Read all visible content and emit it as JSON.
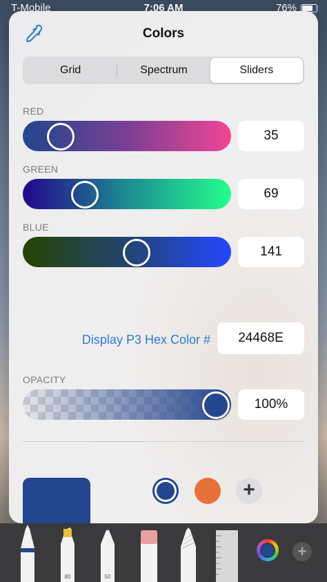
{
  "status_bar": {
    "carrier": "T-Mobile",
    "time": "7:06 AM",
    "battery": "76%"
  },
  "popover": {
    "title": "Colors"
  },
  "segments": [
    {
      "label": "Grid",
      "selected": false
    },
    {
      "label": "Spectrum",
      "selected": false
    },
    {
      "label": "Sliders",
      "selected": true
    }
  ],
  "sliders": {
    "red": {
      "label": "RED",
      "value": "35",
      "level": 35,
      "max": 255
    },
    "green": {
      "label": "GREEN",
      "value": "69",
      "level": 69,
      "max": 255
    },
    "blue": {
      "label": "BLUE",
      "value": "141",
      "level": 141,
      "max": 255
    },
    "opacity": {
      "label": "OPACITY",
      "value": "100%",
      "level": 100,
      "max": 100
    }
  },
  "hex": {
    "label": "Display P3 Hex Color #",
    "value": "24468E"
  },
  "current_color": "#24468e",
  "swatches": [
    "#24468e",
    "#e8703a"
  ],
  "toolbar": {
    "marker_number": "80",
    "pencil_number": "50"
  },
  "colors": {
    "accent_link": "#2b7bd6",
    "swatch_orange": "#e8703a"
  }
}
